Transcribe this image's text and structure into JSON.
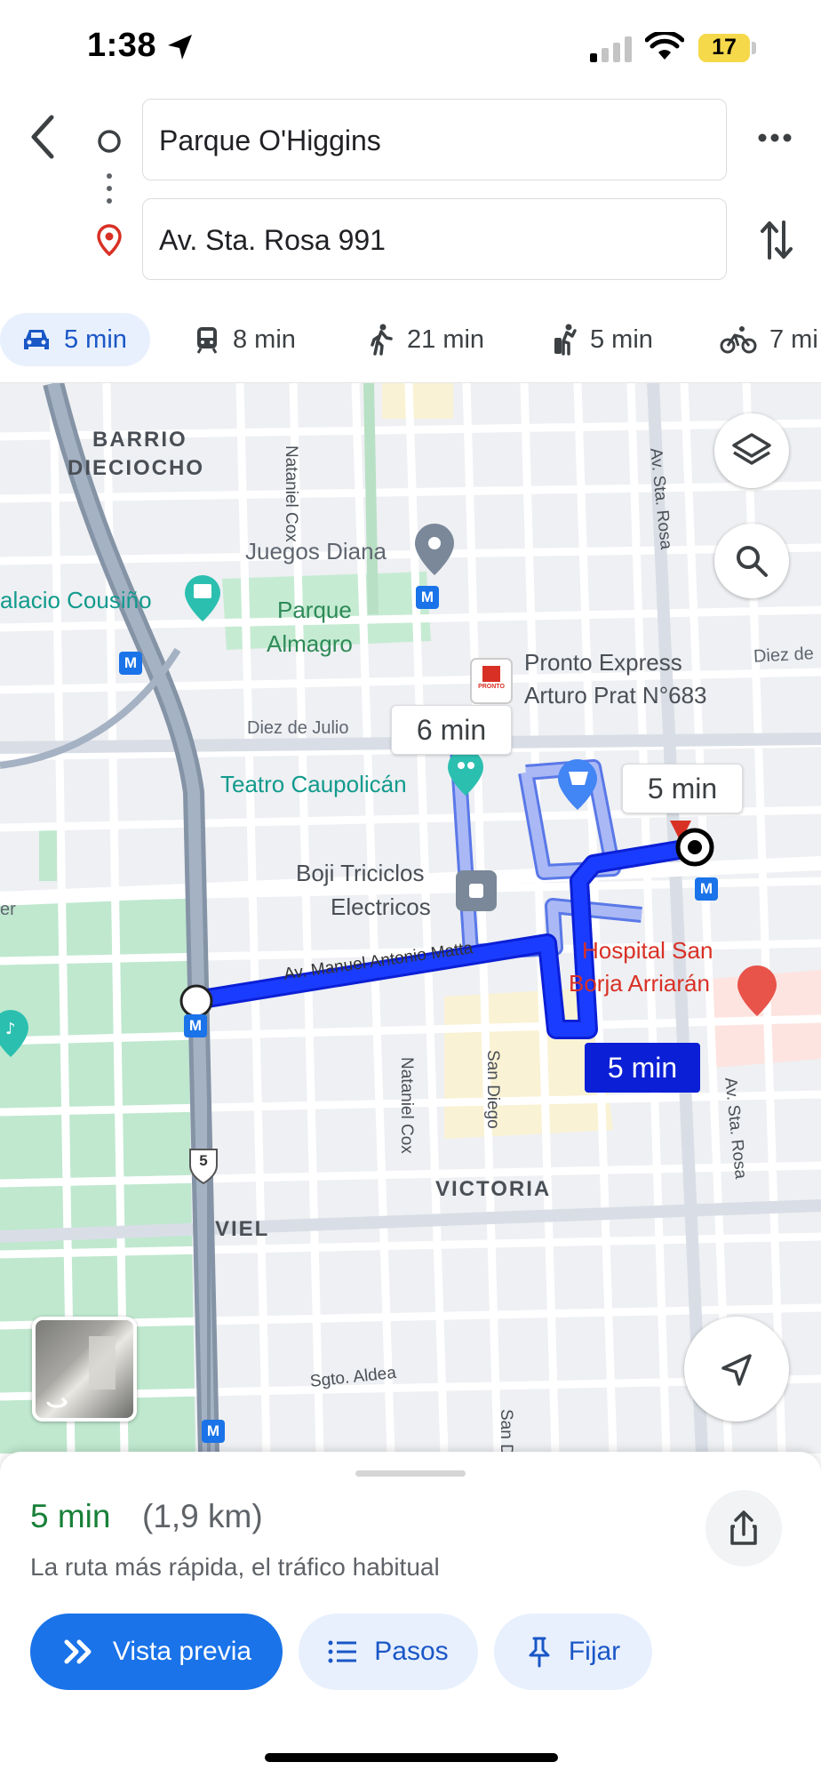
{
  "status_bar": {
    "time": "1:38",
    "battery": "17"
  },
  "directions": {
    "origin": "Parque O'Higgins",
    "destination": "Av. Sta. Rosa 991"
  },
  "modes": [
    {
      "name": "drive",
      "label": "5 min",
      "selected": true
    },
    {
      "name": "transit",
      "label": "8 min"
    },
    {
      "name": "walk",
      "label": "21 min"
    },
    {
      "name": "ride",
      "label": "5 min"
    },
    {
      "name": "bike",
      "label": "7 mi"
    }
  ],
  "map": {
    "labels": {
      "barrio": "BARRIO",
      "dieciocho": "DIECIOCHO",
      "nataniel_cox_top": "Nataniel Cox",
      "juegos_diana": "Juegos Diana",
      "palacio": "alacio Cousiño",
      "parque": "Parque",
      "almagro": "Almagro",
      "pronto_1": "Pronto Express",
      "pronto_2": "Arturo Prat N°683",
      "pronto_logo": "PRONTO",
      "diez_de_right": "Diez de",
      "diez_de_julio": "Diez de Julio",
      "teatro": "Teatro Caupolicán",
      "boji_1": "Boji Triciclos",
      "boji_2": "Electricos",
      "er": "er",
      "matta": "Av. Manuel Antonio Matta",
      "hospital_1": "Hospital San",
      "hospital_2": "Borja Arriarán",
      "nataniel_cox_bottom": "Nataniel Cox",
      "san_diego": "San Diego",
      "san_bottom": "San D",
      "victoria": "VICTORIA",
      "viel": "VIEL",
      "sgto_aldea": "Sgto. Aldea",
      "sta_rosa_top": "Av. Sta. Rosa",
      "sta_rosa_bottom": "Av. Sta. Rosa",
      "route_shield": "5",
      "metro": "M"
    },
    "route_callouts": {
      "alt_1": "6 min",
      "alt_2": "5 min",
      "primary": "5 min"
    }
  },
  "summary": {
    "time": "5 min",
    "distance": "(1,9 km)",
    "description": "La ruta más rápida, el tráfico habitual"
  },
  "actions": {
    "preview": "Vista previa",
    "steps": "Pasos",
    "pin": "Fijar"
  },
  "colors": {
    "accent": "#1a73e8",
    "route_primary": "#1a3cff",
    "route_alt": "#aab9f5",
    "park": "#bfe8cf",
    "eta_green": "#188038"
  }
}
